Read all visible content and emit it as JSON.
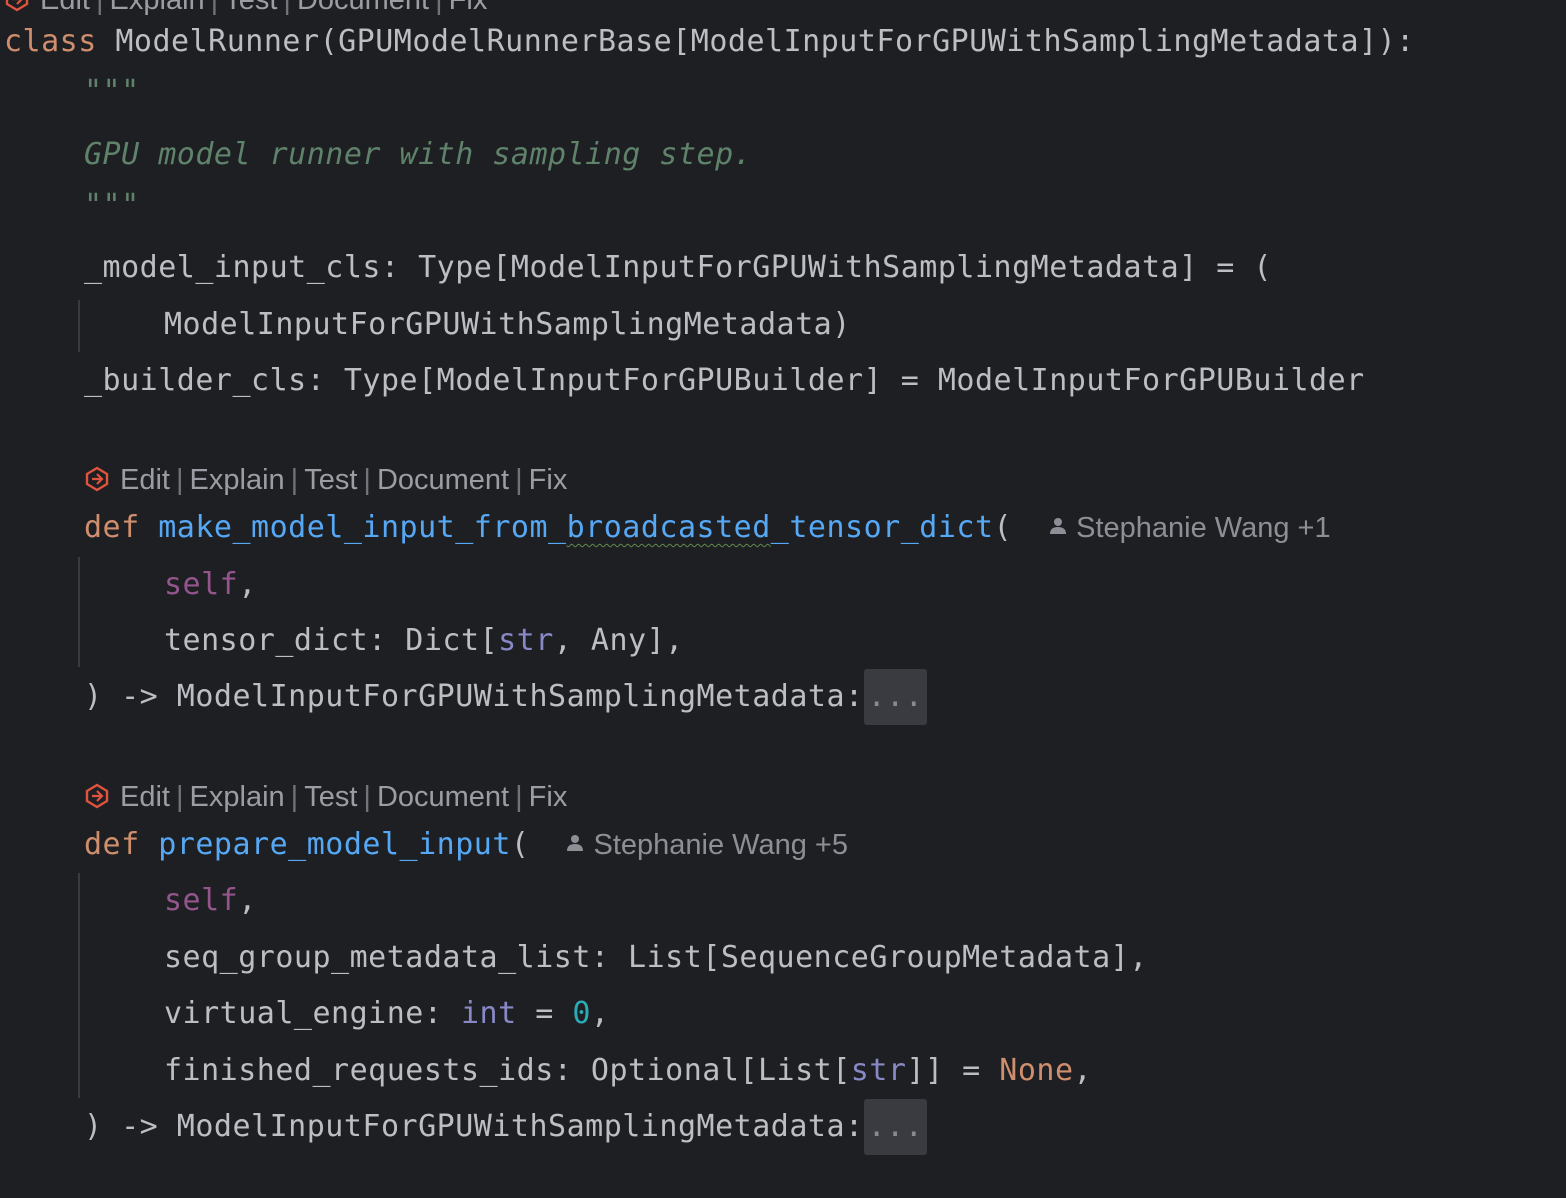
{
  "code_lens": {
    "edit": "Edit",
    "explain": "Explain",
    "test": "Test",
    "document": "Document",
    "fix": "Fix",
    "separator": "|"
  },
  "class_decl": {
    "keyword": "class",
    "name": "ModelRunner",
    "bases": "(GPUModelRunnerBase[ModelInputForGPUWithSamplingMetadata]):"
  },
  "docstring": {
    "open": "\"\"\"",
    "text": "GPU model runner with sampling step.",
    "close": "\"\"\""
  },
  "fields": {
    "model_input_cls_line1": "_model_input_cls: Type[ModelInputForGPUWithSamplingMetadata] = (",
    "model_input_cls_line2": "ModelInputForGPUWithSamplingMetadata)",
    "builder_cls": "_builder_cls: Type[ModelInputForGPUBuilder] = ModelInputForGPUBuilder"
  },
  "method1": {
    "def_kw": "def",
    "name_prefix": "make_model_input_from_",
    "name_squiggle": "broadcasted",
    "name_suffix": "_tensor_dict",
    "open_paren": "(",
    "author": "Stephanie Wang +1",
    "param_self": "self",
    "comma": ",",
    "param2_name": "tensor_dict: Dict[",
    "param2_type": "str",
    "param2_rest": ", Any],",
    "return_line": ") -> ModelInputForGPUWithSamplingMetadata:",
    "fold": "..."
  },
  "method2": {
    "def_kw": "def",
    "name": "prepare_model_input",
    "open_paren": "(",
    "author": "Stephanie Wang +5",
    "param_self": "self",
    "comma": ",",
    "param2": "seq_group_metadata_list: List[SequenceGroupMetadata],",
    "param3_name": "virtual_engine: ",
    "param3_type": "int",
    "param3_eq": " = ",
    "param3_default": "0",
    "param3_comma": ",",
    "param4_name": "finished_requests_ids: Optional[List[",
    "param4_type": "str",
    "param4_mid": "]] = ",
    "param4_default": "None",
    "param4_comma": ",",
    "return_line": ") -> ModelInputForGPUWithSamplingMetadata:",
    "fold": "..."
  },
  "colors": {
    "background": "#1e1f22",
    "keyword": "#cf8e6d",
    "function": "#56a8f5",
    "self": "#94558d",
    "builtin": "#8888c6",
    "number": "#2aacb8",
    "docstring": "#5f826b",
    "text": "#bcbec4",
    "lens_icon": "#e0533d"
  },
  "icons": {
    "lens": "ai-assistant-icon",
    "author": "person-icon"
  }
}
